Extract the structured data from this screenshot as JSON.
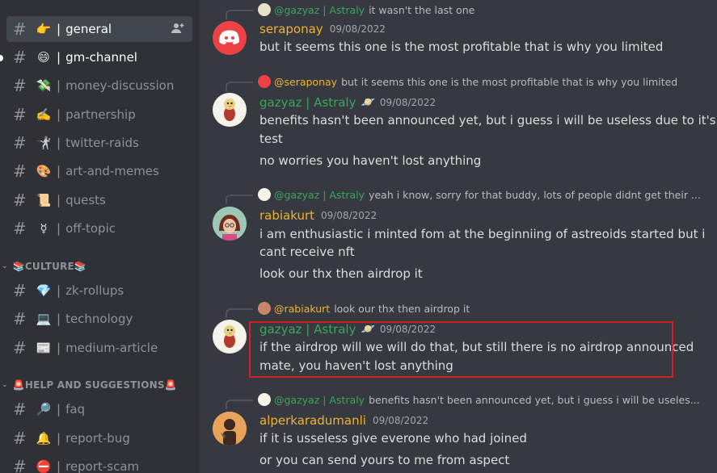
{
  "sidebar": {
    "channels_top": [
      {
        "emoji": "👉",
        "label": "general"
      },
      {
        "emoji": "😄",
        "label": "gm-channel"
      },
      {
        "emoji": "💸",
        "label": "money-discussion"
      },
      {
        "emoji": "✍️",
        "label": "partnership"
      },
      {
        "emoji": "🤺",
        "label": "twitter-raids"
      },
      {
        "emoji": "🎨",
        "label": "art-and-memes"
      },
      {
        "emoji": "📜",
        "label": "quests"
      },
      {
        "emoji": "☿",
        "label": "off-topic"
      }
    ],
    "bar": "|",
    "hash": "#",
    "category_culture": {
      "emoji_l": "📚",
      "label": "CULTURE",
      "emoji_r": "📚"
    },
    "channels_culture": [
      {
        "emoji": "💎",
        "label": "zk-rollups"
      },
      {
        "emoji": "💻",
        "label": "technology"
      },
      {
        "emoji": "📰",
        "label": "medium-article"
      }
    ],
    "category_help": {
      "emoji_l": "🚨",
      "label": "HELP AND SUGGESTIONS",
      "emoji_r": "🚨"
    },
    "channels_help": [
      {
        "emoji": "🔎",
        "label": "faq"
      },
      {
        "emoji": "🔔",
        "label": "report-bug"
      },
      {
        "emoji": "⛔",
        "label": "report-scam"
      }
    ]
  },
  "messages": [
    {
      "reply_user": "@gazyaz | Astraly",
      "reply_text": "it wasn't the last one",
      "user": "seraponay",
      "time": "09/08/2022",
      "lines": [
        "but it seems this one is the most profitable that is why you limited"
      ]
    },
    {
      "reply_user": "@seraponay",
      "reply_text": "but it seems this one is the most profitable that is why you limited",
      "user": "gazyaz | Astraly",
      "planet": "🪐",
      "time": "09/08/2022",
      "lines": [
        "benefits hasn't been announced yet, but i guess i will be useless due to it's",
        "test",
        "no worries you haven't lost anything"
      ]
    },
    {
      "reply_user": "@gazyaz | Astraly",
      "reply_text": "yeah i know, sorry for that buddy, lots of people didnt get their ...",
      "user": "rabiakurt",
      "time": "09/08/2022",
      "lines": [
        "i am enthusiastic i minted fom at the beginniing of astreoids started but i",
        "cant receive nft",
        "look our thx then airdrop it"
      ]
    },
    {
      "reply_user": "@rabiakurt",
      "reply_text": "look our thx then airdrop it",
      "user": "gazyaz | Astraly",
      "planet": "🪐",
      "time": "09/08/2022",
      "lines": [
        "if the airdrop will we will do that, but still there is no airdrop announced",
        "mate, you haven't lost anything"
      ]
    },
    {
      "reply_user": "@gazyaz | Astraly",
      "reply_text": "benefits hasn't been announced yet, but i guess i will be useles...",
      "user": "alperkaradumanli",
      "time": "09/08/2022",
      "lines": [
        "if it is usseless give everone who had joined",
        "or you can send yours to me from aspect"
      ]
    }
  ],
  "colors": {
    "seraponay": "#f0b232",
    "gazyaz": "#3ba55c",
    "rabiakurt": "#f0b232",
    "alperkaradumanli": "#f0b232",
    "highlight": "#d31f24"
  }
}
